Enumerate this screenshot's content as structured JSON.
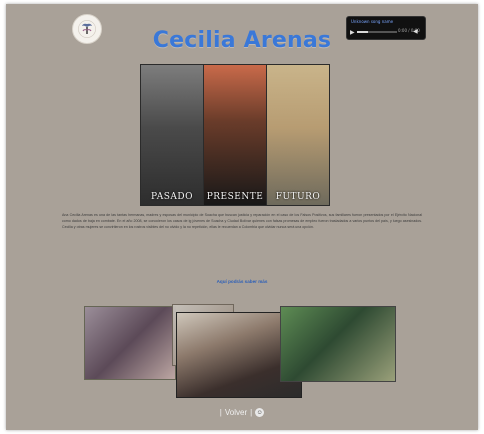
{
  "page": {
    "title": "Cecilia Arenas",
    "bio": "Ana Cecilia Arenas es una de las tantas hermanas, madres y esposas del municipio de Soacha que buscan justicia y reparación en el caso de los Falsos Positivos, sus familiares fueron presentados por el Ejército Nacional como dados de baja en combate. En el año 2008, se conocieron los casos de ig jóvenes de Soacha y Ciudad Bolívar quienes con falsas promesas de empleo fueron trasladados a varios puntos del país, y luego asesinados. Cecilia y otras mujeres se convirtieron en los rostros visibles del no olvido y la no repetición, ellas le recuerdan a Colombia que olvidar nunca será una opción.",
    "more_link": "Aquí podrás saber más"
  },
  "audio_player": {
    "song": "Unknown song name",
    "time": "0:00 / 0:00"
  },
  "panels": [
    {
      "label": "PASADO"
    },
    {
      "label": "PRESENTE"
    },
    {
      "label": "FUTURO"
    }
  ],
  "footer": {
    "left_separator": "|",
    "back_label": "Volver",
    "right_separator": "|"
  },
  "icons": {
    "logo": "tree-logo",
    "play": "play-icon",
    "volume": "volume-icon",
    "footer": "circle-icon"
  }
}
